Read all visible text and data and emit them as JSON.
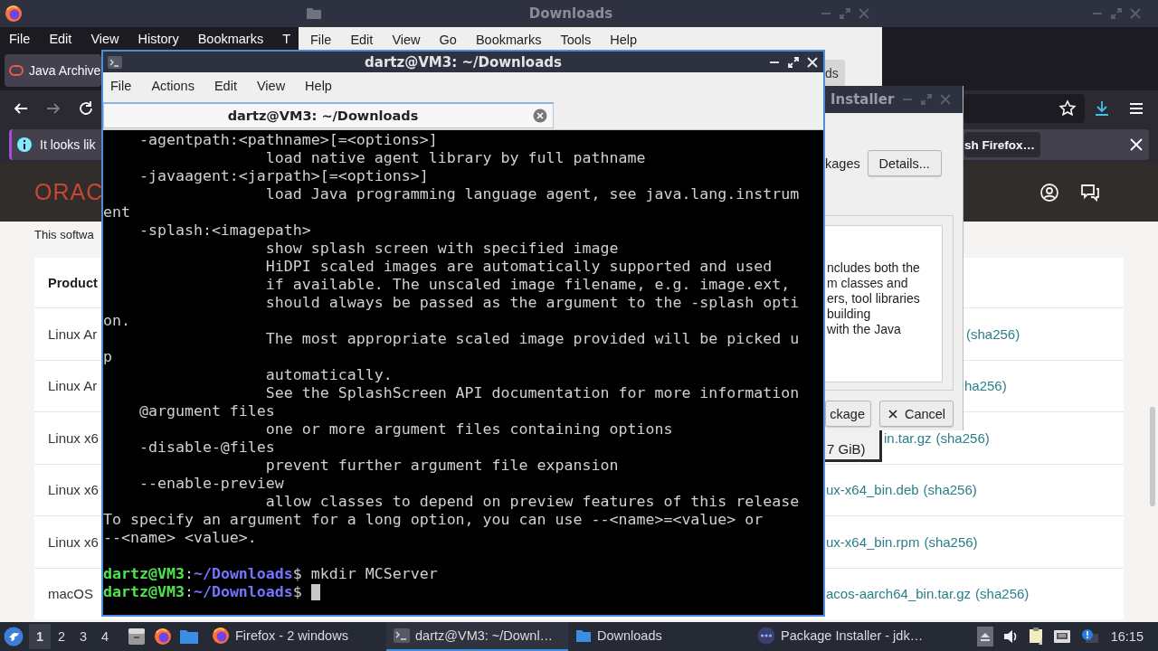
{
  "firefox": {
    "menu": [
      "File",
      "Edit",
      "View",
      "History",
      "Bookmarks",
      "T"
    ],
    "tab": "Java Archive",
    "notification": {
      "text": "It looks lik",
      "button": "sh Firefox…"
    },
    "site": {
      "logo": "ORAC",
      "intro": "This softwa",
      "table": {
        "columns": [
          "Product"
        ],
        "rows": [
          {
            "product": "Linux Ar",
            "checksum": "(sha256)"
          },
          {
            "product": "Linux Ar",
            "checksum": "ha256)"
          },
          {
            "product": "Linux x6",
            "file": "in.tar.gz",
            "checksum": "(sha256)"
          },
          {
            "product": "Linux x6",
            "file": "ux-x64_bin.deb",
            "checksum": "(sha256)"
          },
          {
            "product": "Linux x6",
            "file": "ux-x64_bin.rpm",
            "checksum": "(sha256)"
          },
          {
            "product": "macOS",
            "file": "acos-aarch64_bin.tar.gz",
            "checksum": "(sha256)"
          }
        ]
      }
    },
    "size_label": "7 GiB)"
  },
  "file_manager": {
    "title": "Downloads",
    "menu": [
      "File",
      "Edit",
      "View",
      "Go",
      "Bookmarks",
      "Tools",
      "Help"
    ],
    "tab": "ds"
  },
  "installer": {
    "title": "Installer",
    "summary": "kages",
    "details_button": "Details...",
    "description": [
      "ncludes both the",
      "m classes and",
      "ers, tool libraries",
      "building",
      "with the Java"
    ],
    "buttons": [
      {
        "label": "ckage",
        "kind": "plain"
      },
      {
        "label": "Cancel",
        "kind": "cancel"
      }
    ]
  },
  "terminal": {
    "title": "dartz@VM3: ~/Downloads",
    "menu": [
      "File",
      "Actions",
      "Edit",
      "View",
      "Help"
    ],
    "tab": "dartz@VM3: ~/Downloads",
    "output": [
      "    -agentpath:<pathname>[=<options>]",
      "                  load native agent library by full pathname",
      "    -javaagent:<jarpath>[=<options>]",
      "                  load Java programming language agent, see java.lang.instrum",
      "ent",
      "    -splash:<imagepath>",
      "                  show splash screen with specified image",
      "                  HiDPI scaled images are automatically supported and used",
      "                  if available. The unscaled image filename, e.g. image.ext,",
      "                  should always be passed as the argument to the -splash opti",
      "on.",
      "                  The most appropriate scaled image provided will be picked u",
      "p",
      "                  automatically.",
      "                  See the SplashScreen API documentation for more information",
      "    @argument files",
      "                  one or more argument files containing options",
      "    -disable-@files",
      "                  prevent further argument file expansion",
      "    --enable-preview",
      "                  allow classes to depend on preview features of this release",
      "To specify an argument for a long option, you can use --<name>=<value> or",
      "--<name> <value>."
    ],
    "prompts": [
      {
        "user": "dartz@VM3",
        "separator": ":",
        "path": "~/Downloads",
        "symbol": "$",
        "command": "mkdir MCServer",
        "cursor": false
      },
      {
        "user": "dartz@VM3",
        "separator": ":",
        "path": "~/Downloads",
        "symbol": "$",
        "cursor": true
      }
    ]
  },
  "taskbar": {
    "workspaces": [
      {
        "label": "1",
        "selected": true
      },
      {
        "label": "2",
        "selected": false
      },
      {
        "label": "3",
        "selected": false
      },
      {
        "label": "4",
        "selected": false
      }
    ],
    "tasks": [
      {
        "label": "Firefox - 2 windows",
        "kind": "browser",
        "selected": false
      },
      {
        "label": "dartz@VM3: ~/Downl…",
        "kind": "terminal",
        "selected": true
      },
      {
        "label": "Downloads",
        "kind": "files",
        "selected": false
      },
      {
        "label": "Package Installer - jdk…",
        "kind": "installer",
        "selected": false
      }
    ],
    "clock": "16:15"
  }
}
